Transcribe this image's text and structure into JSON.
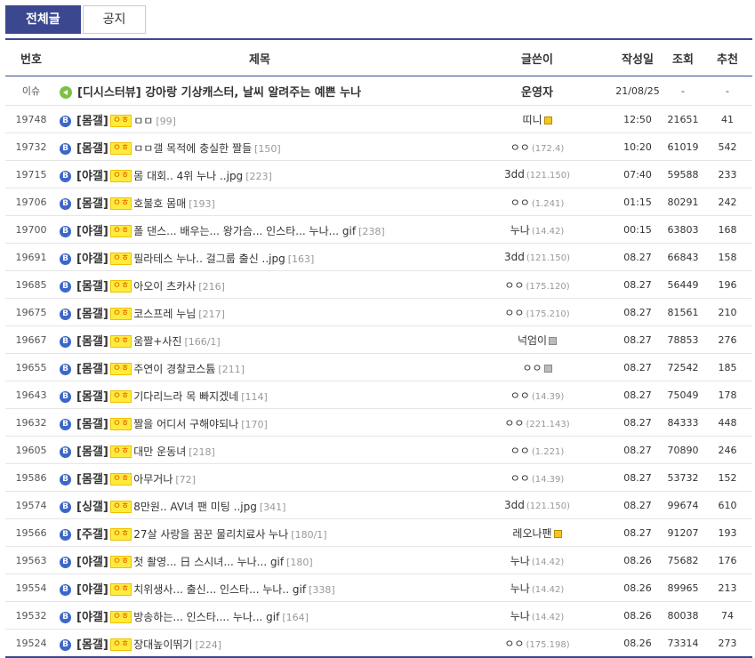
{
  "tabs": {
    "all": "전체글",
    "notice": "공지"
  },
  "headers": {
    "num": "번호",
    "title": "제목",
    "writer": "글쓴이",
    "date": "작성일",
    "views": "조회",
    "recommend": "추천"
  },
  "notice": {
    "num": "이슈",
    "title": "[디시스터뷰] 강아랑 기상캐스터, 날씨 알려주는 예쁜 누나",
    "writer": "운영자",
    "date": "21/08/25",
    "views": "-",
    "recommend": "-"
  },
  "rows": [
    {
      "num": "19748",
      "cat": "[몸갤]",
      "tag": "ㅇㅎ",
      "subj": "ㅁㅁ",
      "cmt": "[99]",
      "writer": "띠니",
      "ip": "",
      "badge": "gold",
      "date": "12:50",
      "views": "21651",
      "rec": "41"
    },
    {
      "num": "19732",
      "cat": "[몸갤]",
      "tag": "ㅇㅎ",
      "subj": "ㅁㅁ갤 목적에 충실한 짤들",
      "cmt": "[150]",
      "writer": "ㅇㅇ",
      "ip": "(172.4)",
      "badge": "",
      "date": "10:20",
      "views": "61019",
      "rec": "542"
    },
    {
      "num": "19715",
      "cat": "[야갤]",
      "tag": "ㅇㅎ",
      "subj": "몸 대회.. 4위 누나 ..jpg",
      "cmt": "[223]",
      "writer": "3dd",
      "ip": "(121.150)",
      "badge": "",
      "date": "07:40",
      "views": "59588",
      "rec": "233"
    },
    {
      "num": "19706",
      "cat": "[몸갤]",
      "tag": "ㅇㅎ",
      "subj": "호불호 몸매",
      "cmt": "[193]",
      "writer": "ㅇㅇ",
      "ip": "(1.241)",
      "badge": "",
      "date": "01:15",
      "views": "80291",
      "rec": "242"
    },
    {
      "num": "19700",
      "cat": "[야갤]",
      "tag": "ㅇㅎ",
      "subj": "폴 댄스... 배우는... 왕가슴... 인스타... 누나... gif",
      "cmt": "[238]",
      "writer": "누나",
      "ip": "(14.42)",
      "badge": "",
      "date": "00:15",
      "views": "63803",
      "rec": "168"
    },
    {
      "num": "19691",
      "cat": "[야갤]",
      "tag": "ㅇㅎ",
      "subj": "필라테스 누나.. 걸그룹 출신 ..jpg",
      "cmt": "[163]",
      "writer": "3dd",
      "ip": "(121.150)",
      "badge": "",
      "date": "08.27",
      "views": "66843",
      "rec": "158"
    },
    {
      "num": "19685",
      "cat": "[몸갤]",
      "tag": "ㅇㅎ",
      "subj": "아오이 츠카사",
      "cmt": "[216]",
      "writer": "ㅇㅇ",
      "ip": "(175.120)",
      "badge": "",
      "date": "08.27",
      "views": "56449",
      "rec": "196"
    },
    {
      "num": "19675",
      "cat": "[몸갤]",
      "tag": "ㅇㅎ",
      "subj": "코스프레 누님",
      "cmt": "[217]",
      "writer": "ㅇㅇ",
      "ip": "(175.210)",
      "badge": "",
      "date": "08.27",
      "views": "81561",
      "rec": "210"
    },
    {
      "num": "19667",
      "cat": "[몸갤]",
      "tag": "ㅇㅎ",
      "subj": "움짤+사진",
      "cmt": "[166/1]",
      "writer": "넉엄이",
      "ip": "",
      "badge": "gray",
      "date": "08.27",
      "views": "78853",
      "rec": "276"
    },
    {
      "num": "19655",
      "cat": "[몸갤]",
      "tag": "ㅇㅎ",
      "subj": "주연이 경찰코스튬",
      "cmt": "[211]",
      "writer": "ㅇㅇ",
      "ip": "",
      "badge": "gray",
      "date": "08.27",
      "views": "72542",
      "rec": "185"
    },
    {
      "num": "19643",
      "cat": "[몸갤]",
      "tag": "ㅇㅎ",
      "subj": "기다리느라 목 빠지겠네",
      "cmt": "[114]",
      "writer": "ㅇㅇ",
      "ip": "(14.39)",
      "badge": "",
      "date": "08.27",
      "views": "75049",
      "rec": "178"
    },
    {
      "num": "19632",
      "cat": "[몸갤]",
      "tag": "ㅇㅎ",
      "subj": "짤을 어디서 구해야되나",
      "cmt": "[170]",
      "writer": "ㅇㅇ",
      "ip": "(221.143)",
      "badge": "",
      "date": "08.27",
      "views": "84333",
      "rec": "448"
    },
    {
      "num": "19605",
      "cat": "[몸갤]",
      "tag": "ㅇㅎ",
      "subj": "대만 운동녀",
      "cmt": "[218]",
      "writer": "ㅇㅇ",
      "ip": "(1.221)",
      "badge": "",
      "date": "08.27",
      "views": "70890",
      "rec": "246"
    },
    {
      "num": "19586",
      "cat": "[몸갤]",
      "tag": "ㅇㅎ",
      "subj": "아무거나",
      "cmt": "[72]",
      "writer": "ㅇㅇ",
      "ip": "(14.39)",
      "badge": "",
      "date": "08.27",
      "views": "53732",
      "rec": "152"
    },
    {
      "num": "19574",
      "cat": "[싱갤]",
      "tag": "ㅇㅎ",
      "subj": "8만원.. AV녀 팬 미팅 ..jpg",
      "cmt": "[341]",
      "writer": "3dd",
      "ip": "(121.150)",
      "badge": "",
      "date": "08.27",
      "views": "99674",
      "rec": "610"
    },
    {
      "num": "19566",
      "cat": "[주갤]",
      "tag": "ㅇㅎ",
      "subj": "27살 사랑을 꿈꾼 물리치료사 누나",
      "cmt": "[180/1]",
      "writer": "레오나팬",
      "ip": "",
      "badge": "gold",
      "date": "08.27",
      "views": "91207",
      "rec": "193"
    },
    {
      "num": "19563",
      "cat": "[야갤]",
      "tag": "ㅇㅎ",
      "subj": "첫 촬영... 日 스시녀... 누나... gif",
      "cmt": "[180]",
      "writer": "누나",
      "ip": "(14.42)",
      "badge": "",
      "date": "08.26",
      "views": "75682",
      "rec": "176"
    },
    {
      "num": "19554",
      "cat": "[야갤]",
      "tag": "ㅇㅎ",
      "subj": "치위생사... 출신... 인스타... 누나.. gif",
      "cmt": "[338]",
      "writer": "누나",
      "ip": "(14.42)",
      "badge": "",
      "date": "08.26",
      "views": "89965",
      "rec": "213"
    },
    {
      "num": "19532",
      "cat": "[야갤]",
      "tag": "ㅇㅎ",
      "subj": "방송하는... 인스타.... 누나... gif",
      "cmt": "[164]",
      "writer": "누나",
      "ip": "(14.42)",
      "badge": "",
      "date": "08.26",
      "views": "80038",
      "rec": "74"
    },
    {
      "num": "19524",
      "cat": "[몸갤]",
      "tag": "ㅇㅎ",
      "subj": "장대높이뛰기",
      "cmt": "[224]",
      "writer": "ㅇㅇ",
      "ip": "(175.198)",
      "badge": "",
      "date": "08.26",
      "views": "73314",
      "rec": "273"
    }
  ]
}
